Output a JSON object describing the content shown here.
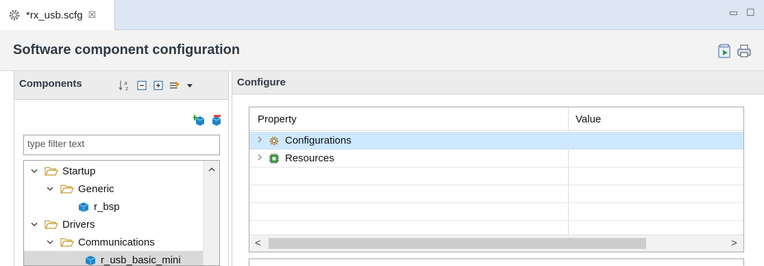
{
  "tab": {
    "label": "*rx_usb.scfg",
    "close_glyph": "☒",
    "icon": "gear-icon"
  },
  "window_controls": {
    "minimize_glyph": "▭",
    "maximize_glyph": "☐"
  },
  "header": {
    "title": "Software component configuration",
    "icons": [
      "generate-code-icon",
      "print-icon"
    ]
  },
  "components": {
    "title": "Components",
    "toolbar_icons": [
      "sort-alpha-icon",
      "collapse-all-icon",
      "expand-all-icon",
      "filter-icon",
      "dropdown-arrow-icon"
    ],
    "action_icons": [
      "add-component-icon",
      "remove-component-icon"
    ],
    "filter_placeholder": "type filter text",
    "tree": [
      {
        "label": "Startup",
        "type": "folder",
        "expanded": true,
        "level": 0
      },
      {
        "label": "Generic",
        "type": "folder",
        "expanded": true,
        "level": 1
      },
      {
        "label": "r_bsp",
        "type": "component",
        "level": 2
      },
      {
        "label": "Drivers",
        "type": "folder",
        "expanded": true,
        "level": 0
      },
      {
        "label": "Communications",
        "type": "folder",
        "expanded": true,
        "level": 1
      },
      {
        "label": "r_usb_basic_mini",
        "type": "component",
        "level": 2,
        "selected": true
      }
    ]
  },
  "configure": {
    "title": "Configure",
    "columns": [
      "Property",
      "Value"
    ],
    "rows": [
      {
        "label": "Configurations",
        "icon": "gear-icon",
        "highlighted": true
      },
      {
        "label": "Resources",
        "icon": "chip-icon",
        "highlighted": false
      }
    ],
    "scroll_left": "<",
    "scroll_right": ">"
  },
  "colors": {
    "tab_bar": "#dde6f3",
    "header_bg": "#f3f3f3",
    "panel_header": "#ececec",
    "row_highlight": "#cde8ff",
    "tree_selected": "#d9d9d9",
    "folder_outline": "#c99a2e"
  }
}
